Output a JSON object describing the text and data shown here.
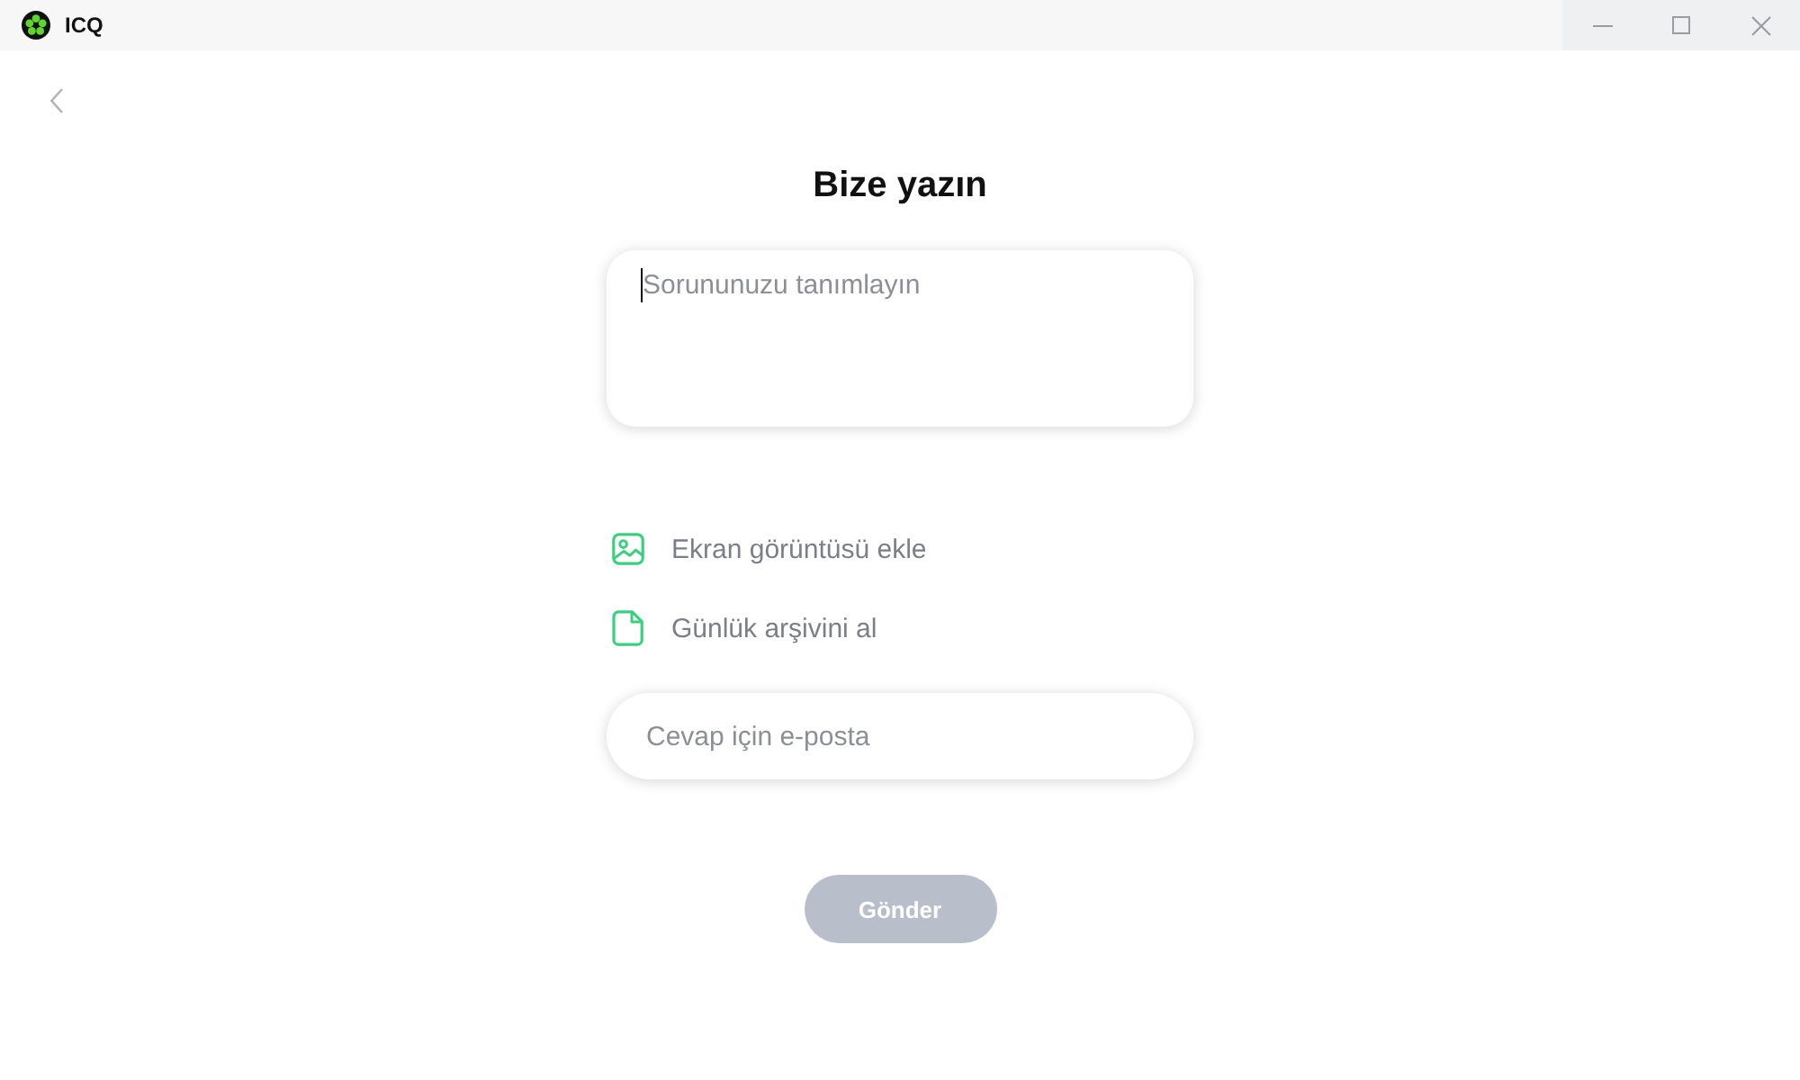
{
  "window": {
    "title": "ICQ"
  },
  "form": {
    "title": "Bize yazın",
    "description_field": {
      "placeholder": "Sorununuzu tanımlayın",
      "focused": true
    },
    "actions": [
      {
        "kind": "screenshot",
        "label": "Ekran görüntüsü ekle"
      },
      {
        "kind": "log",
        "label": "Günlük arşivini al"
      }
    ],
    "email_field": {
      "placeholder": "Cevap için e-posta"
    },
    "submit": {
      "label": "Gönder",
      "disabled": true
    }
  }
}
